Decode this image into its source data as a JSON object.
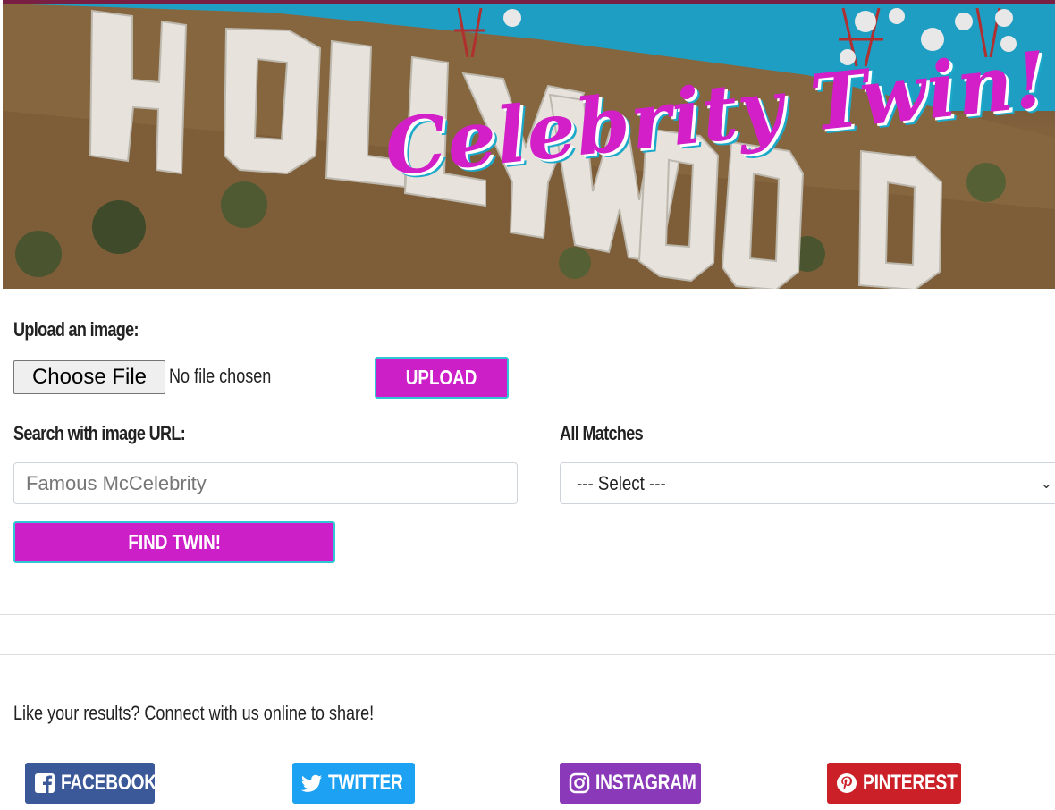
{
  "hero": {
    "title": "Celebrity Twin!",
    "sign_text": "HOLLYWOOD"
  },
  "upload": {
    "label": "Upload an image:",
    "choose_file_label": "Choose File",
    "file_status": "No file chosen",
    "upload_button": "UPLOAD"
  },
  "search": {
    "label": "Search with image URL:",
    "placeholder": "Famous McCelebrity",
    "find_button": "FIND TWIN!"
  },
  "matches": {
    "label": "All Matches",
    "selected": "--- Select ---"
  },
  "share": {
    "text": "Like your results? Connect with us online to share!",
    "buttons": [
      {
        "label": "FACEBOOK",
        "icon": "facebook-icon",
        "color": "#3b5998"
      },
      {
        "label": "TWITTER",
        "icon": "twitter-icon",
        "color": "#1da1f2"
      },
      {
        "label": "INSTAGRAM",
        "icon": "instagram-icon",
        "color": "#8a3ab9"
      },
      {
        "label": "PINTEREST",
        "icon": "pinterest-icon",
        "color": "#cb2027"
      }
    ]
  },
  "colors": {
    "accent": "#cc1fc8",
    "accent_border": "#31c6d6"
  }
}
